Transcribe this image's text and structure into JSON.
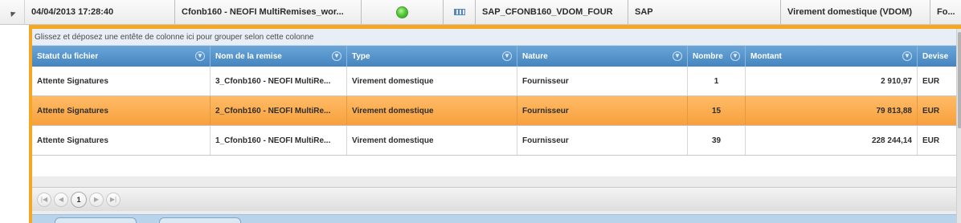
{
  "parent_row": {
    "datetime": "04/04/2013 17:28:40",
    "remise_name": "Cfonb160 - NEOFI MultiRemises_wor...",
    "status_icon": "green-status-icon",
    "type_icon": "file-format-icon",
    "format_code": "SAP_CFONB160_VDOM_FOUR",
    "source": "SAP",
    "payment_type": "Virement domestique (VDOM)",
    "truncated": "Fo..."
  },
  "group_panel": {
    "hint": "Glissez et déposez une entête de colonne ici pour grouper selon cette colonne"
  },
  "columns": [
    {
      "label": "Statut du fichier",
      "filter": true
    },
    {
      "label": "Nom de la remise",
      "filter": true
    },
    {
      "label": "Type",
      "filter": true
    },
    {
      "label": "Nature",
      "filter": true
    },
    {
      "label": "Nombre",
      "filter": true
    },
    {
      "label": "Montant",
      "filter": true
    },
    {
      "label": "Devise",
      "filter": false
    }
  ],
  "rows": [
    {
      "statut": "Attente Signatures",
      "nom": "3_Cfonb160 - NEOFI MultiRe...",
      "type": "Virement domestique",
      "nature": "Fournisseur",
      "nombre": "1",
      "montant": "2 910,97",
      "devise": "EUR",
      "selected": false
    },
    {
      "statut": "Attente Signatures",
      "nom": "2_Cfonb160 - NEOFI MultiRe...",
      "type": "Virement domestique",
      "nature": "Fournisseur",
      "nombre": "15",
      "montant": "79 813,88",
      "devise": "EUR",
      "selected": true
    },
    {
      "statut": "Attente Signatures",
      "nom": "1_Cfonb160 - NEOFI MultiRe...",
      "type": "Virement domestique",
      "nature": "Fournisseur",
      "nombre": "39",
      "montant": "228 244,14",
      "devise": "EUR",
      "selected": false
    }
  ],
  "pager": {
    "first_icon": "first-page-icon",
    "prev_icon": "prev-page-icon",
    "current_page": "1",
    "next_icon": "next-page-icon",
    "last_icon": "last-page-icon"
  },
  "colors": {
    "header_blue": "#4584bf",
    "selection_orange": "#f7a03c",
    "detail_border": "#f5a623"
  }
}
